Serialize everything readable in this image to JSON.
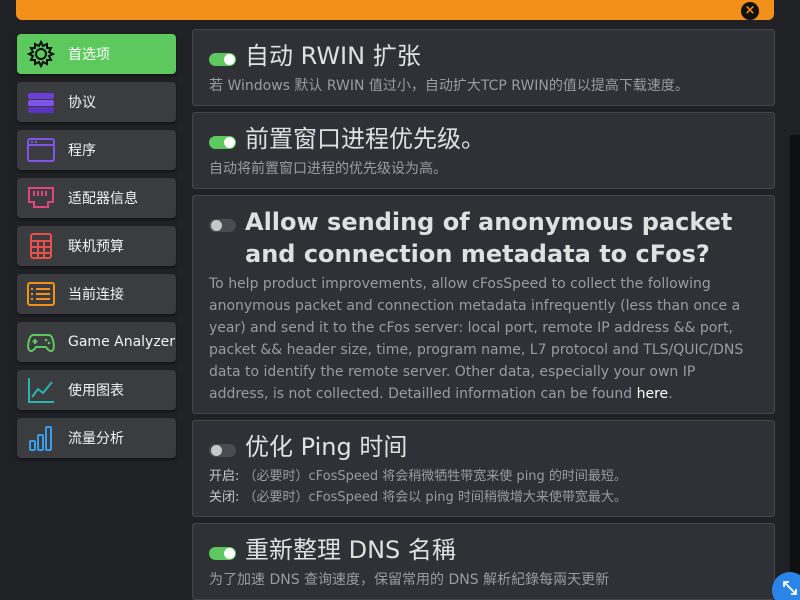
{
  "colors": {
    "accent_orange": "#f39019",
    "active_green": "#5cc85e",
    "fab_blue": "#2b84e8"
  },
  "close_icon": "×",
  "sidebar": {
    "items": [
      {
        "label": "首选项",
        "icon": "gear-icon",
        "active": true
      },
      {
        "label": "协议",
        "icon": "layers-icon",
        "active": false
      },
      {
        "label": "程序",
        "icon": "window-icon",
        "active": false
      },
      {
        "label": "适配器信息",
        "icon": "network-port-icon",
        "active": false
      },
      {
        "label": "联机预算",
        "icon": "calculator-icon",
        "active": false
      },
      {
        "label": "当前连接",
        "icon": "connection-list-icon",
        "active": false
      },
      {
        "label": "Game Analyzer",
        "icon": "gamepad-icon",
        "active": false
      },
      {
        "label": "使用图表",
        "icon": "line-chart-icon",
        "active": false
      },
      {
        "label": "流量分析",
        "icon": "bar-chart-icon",
        "active": false
      }
    ]
  },
  "settings": [
    {
      "title": "自动 RWIN 扩张",
      "enabled": true,
      "desc": "若 Windows 默认 RWIN 值过小，自动扩大TCP RWIN的值以提高下载速度。"
    },
    {
      "title": "前置窗口进程优先级。",
      "enabled": true,
      "desc": "自动将前置窗口进程的优先级设为高。"
    },
    {
      "title": "Allow sending of anonymous packet and connection metadata to cFos?",
      "enabled": false,
      "desc": "To help product improvements, allow cFosSpeed to collect the following anonymous packet and connection metadata infrequently (less than once a year) and send it to the cFos server: local port, remote IP address && port, packet && header size, time, program name, L7 protocol and TLS/QUIC/DNS data to identify the remote server. Other data, especially your own IP address, is not collected. Detailled information can be found ",
      "link": "here",
      "desc_end": "."
    },
    {
      "title": "优化 Ping 时间",
      "enabled": false,
      "on_label": "开启:",
      "on_desc": "（必要时）cFosSpeed 将会稍微牺牲带宽来使 ping 的时间最短。",
      "off_label": "关闭:",
      "off_desc": "（必要时）cFosSpeed 将会以 ping 时间稍微增大来使带宽最大。"
    },
    {
      "title": "重新整理 DNS 名稱",
      "enabled": true,
      "desc": "为了加速 DNS 查询速度，保留常用的 DNS 解析紀錄每兩天更新"
    }
  ]
}
